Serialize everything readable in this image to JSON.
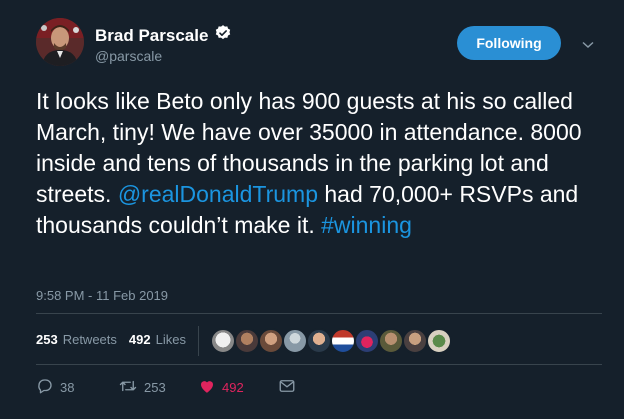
{
  "author": {
    "name": "Brad Parscale",
    "handle": "@parscale",
    "verified": true
  },
  "follow_button": {
    "label": "Following"
  },
  "tweet": {
    "segments": [
      {
        "text": "It looks like Beto only has 900 guests at his so called March, tiny! We have over 35000 in attendance. 8000 inside and tens of thousands in the parking lot and streets. ",
        "link": false
      },
      {
        "text": "@realDonaldTrump",
        "link": true
      },
      {
        "text": " had 70,000+ RSVPs and thousands couldn’t make it. ",
        "link": false
      },
      {
        "text": "#winning",
        "link": true
      }
    ],
    "timestamp": "9:58 PM - 11 Feb 2019"
  },
  "stats": {
    "retweets_count": "253",
    "retweets_label": "Retweets",
    "likes_count": "492",
    "likes_label": "Likes"
  },
  "actions": {
    "replies": "38",
    "retweets": "253",
    "likes": "492"
  },
  "liker_avatars": [
    "avatar-1",
    "avatar-2",
    "avatar-3",
    "avatar-4",
    "avatar-5",
    "avatar-6",
    "avatar-7",
    "avatar-8",
    "avatar-9",
    "avatar-10"
  ],
  "colors": {
    "background": "#15202b",
    "link": "#1b95e0",
    "muted": "#8899a6",
    "like": "#e0245e",
    "button": "#2a8fd4"
  }
}
